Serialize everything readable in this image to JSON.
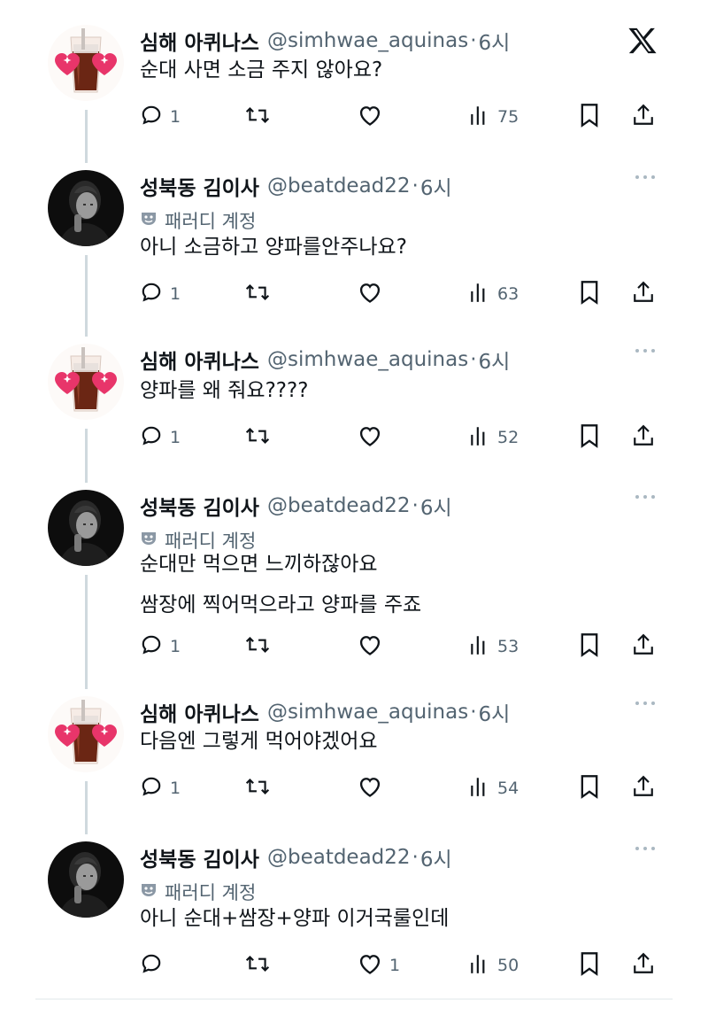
{
  "tweets": [
    {
      "name": "심해 아퀴나스",
      "handle": "@simhwae_aquinas",
      "dot": "·",
      "time": "6시",
      "avatar": "drink",
      "parody": false,
      "lines": [
        "순대 사면 소금 주지 않아요?"
      ],
      "reply_count": "1",
      "like_count": "",
      "view_count": "75"
    },
    {
      "name": "성북동 김이사",
      "handle": "@beatdead22",
      "dot": "·",
      "time": "6시",
      "avatar": "person",
      "parody": true,
      "lines": [
        "아니 소금하고 양파를안주나요?"
      ],
      "reply_count": "1",
      "like_count": "",
      "view_count": "63"
    },
    {
      "name": "심해 아퀴나스",
      "handle": "@simhwae_aquinas",
      "dot": "·",
      "time": "6시",
      "avatar": "drink",
      "parody": false,
      "lines": [
        "양파를 왜 줘요????"
      ],
      "reply_count": "1",
      "like_count": "",
      "view_count": "52"
    },
    {
      "name": "성북동 김이사",
      "handle": "@beatdead22",
      "dot": "·",
      "time": "6시",
      "avatar": "person",
      "parody": true,
      "lines": [
        "순대만 먹으면 느끼하잖아요",
        "쌈장에 찍어먹으라고 양파를 주죠"
      ],
      "reply_count": "1",
      "like_count": "",
      "view_count": "53"
    },
    {
      "name": "심해 아퀴나스",
      "handle": "@simhwae_aquinas",
      "dot": "·",
      "time": "6시",
      "avatar": "drink",
      "parody": false,
      "lines": [
        "다음엔 그렇게 먹어야겠어요"
      ],
      "reply_count": "1",
      "like_count": "",
      "view_count": "54"
    },
    {
      "name": "성북동 김이사",
      "handle": "@beatdead22",
      "dot": "·",
      "time": "6시",
      "avatar": "person",
      "parody": true,
      "lines": [
        "아니 순대+쌈장+양파 이거국룰인데"
      ],
      "reply_count": "",
      "like_count": "1",
      "view_count": "50"
    }
  ],
  "parody_label": "패러디 계정",
  "icons": {
    "reply": "reply-icon",
    "retweet": "retweet-icon",
    "like": "heart-icon",
    "views": "views-icon",
    "bookmark": "bookmark-icon",
    "share": "share-icon",
    "more": "more-icon",
    "logo": "x-logo-icon"
  },
  "colors": {
    "text": "#0f1419",
    "secondary": "#536471",
    "thread_line": "#cfd9de",
    "heart_pink": "#e8356a",
    "drink_brown": "#7a2f1a"
  }
}
